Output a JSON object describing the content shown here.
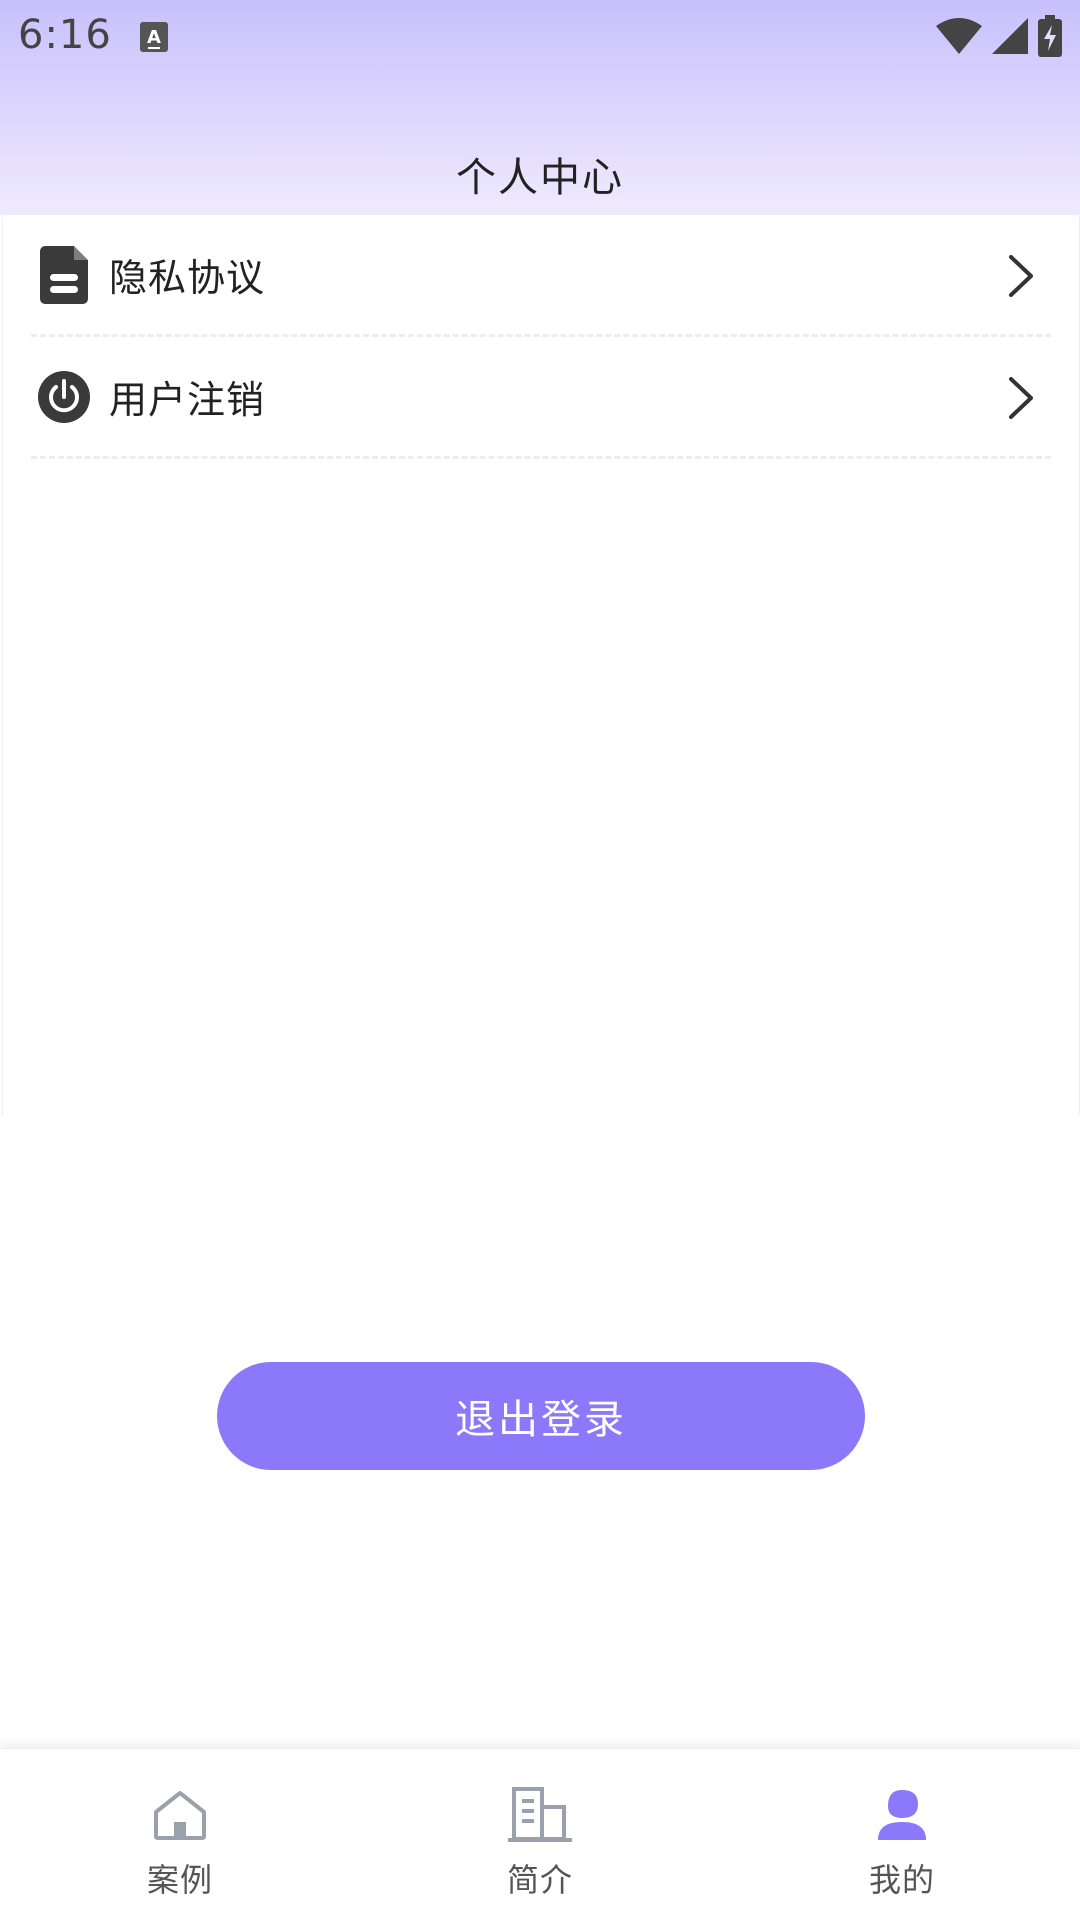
{
  "status_bar": {
    "time": "6:16",
    "a_icon_glyph": "A"
  },
  "header": {
    "title": "个人中心"
  },
  "menu": {
    "items": [
      {
        "label": "隐私协议",
        "icon": "document-icon"
      },
      {
        "label": "用户注销",
        "icon": "power-icon"
      }
    ]
  },
  "logout": {
    "label": "退出登录"
  },
  "tabs": [
    {
      "label": "案例",
      "icon": "home-icon",
      "active": false
    },
    {
      "label": "简介",
      "icon": "building-icon",
      "active": false
    },
    {
      "label": "我的",
      "icon": "person-icon",
      "active": true
    }
  ],
  "colors": {
    "accent": "#8b78fa",
    "header_top": "#c8c0fb",
    "header_bottom": "#efebfe",
    "icon_dark": "#3a3a3a",
    "tab_inactive_icon": "#9aa0ac"
  }
}
